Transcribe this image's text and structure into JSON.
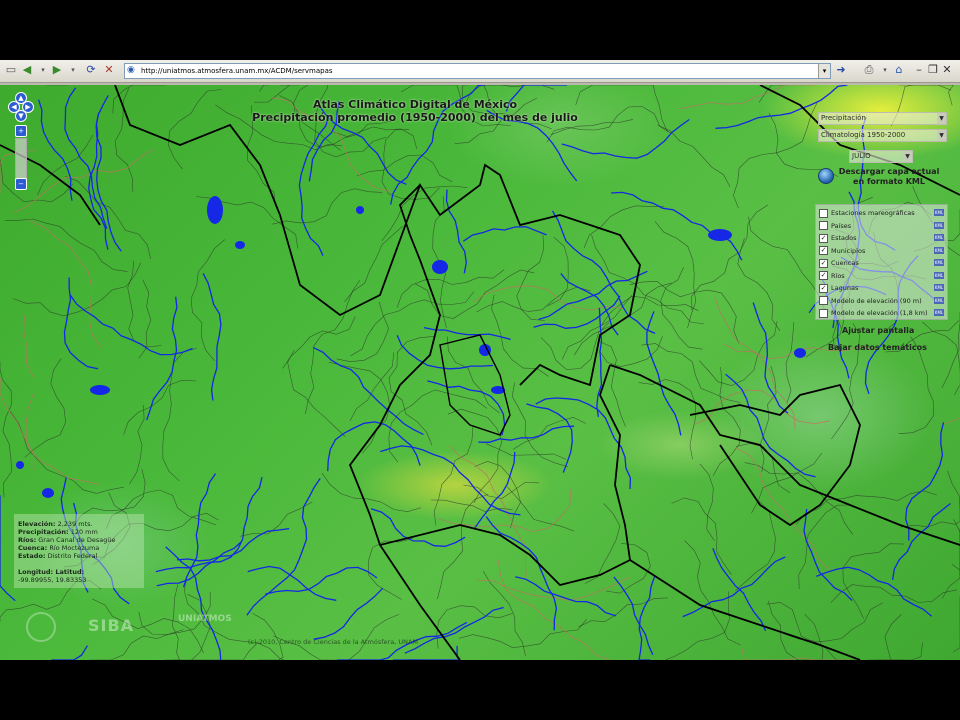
{
  "browser": {
    "url": "http://uniatmos.atmosfera.unam.mx/ACDM/servmapas"
  },
  "map": {
    "title_line1": "Atlas Climático Digital de México",
    "title_line2": "Precipitación promedio (1950-2000) del mes de julio",
    "colors": {
      "water": "#1428e6",
      "state_border": "#000000",
      "municipal_border": "#2a2a2a",
      "basin_border": "#c07060"
    }
  },
  "controls": {
    "variable_select": "Precipitación",
    "dataset_select": "Climatología 1950-2000",
    "month_select": "JULIO",
    "download_line1": "Descargar capa actual",
    "download_line2": "en formato KML",
    "layers": [
      {
        "label": "Estaciones mareográficas",
        "checked": false
      },
      {
        "label": "Países",
        "checked": false
      },
      {
        "label": "Estados",
        "checked": true
      },
      {
        "label": "Municipios",
        "checked": true
      },
      {
        "label": "Cuencas",
        "checked": true
      },
      {
        "label": "Ríos",
        "checked": true
      },
      {
        "label": "Lagunas",
        "checked": true
      },
      {
        "label": "Modelo de elevación (90 m)",
        "checked": false
      },
      {
        "label": "Modelo de elevación (1,8 km)",
        "checked": false
      }
    ],
    "kml_label": "KML",
    "fit_screen": "Ajustar pantalla",
    "download_data": "Bajar datos temáticos"
  },
  "info": {
    "elevacion_label": "Elevación:",
    "elevacion_value": "2,239 mts.",
    "precip_label": "Precipitación:",
    "precip_value": "120 mm",
    "rios_label": "Ríos:",
    "rios_value": "Gran Canal de Desagüe",
    "cuenca_label": "Cuenca:",
    "cuenca_value": "Río Moctezuma",
    "estado_label": "Estado:",
    "estado_value": "Distrito Federal",
    "coord_header": "Longitud:   Latitud:",
    "coord_value": "-99.89955, 19.83353"
  },
  "footer": {
    "siba": "SIBA",
    "unam": "UNIATMOS",
    "copyright": "(c) 2010, Centro de Ciencias de la Atmósfera, UNAM"
  }
}
